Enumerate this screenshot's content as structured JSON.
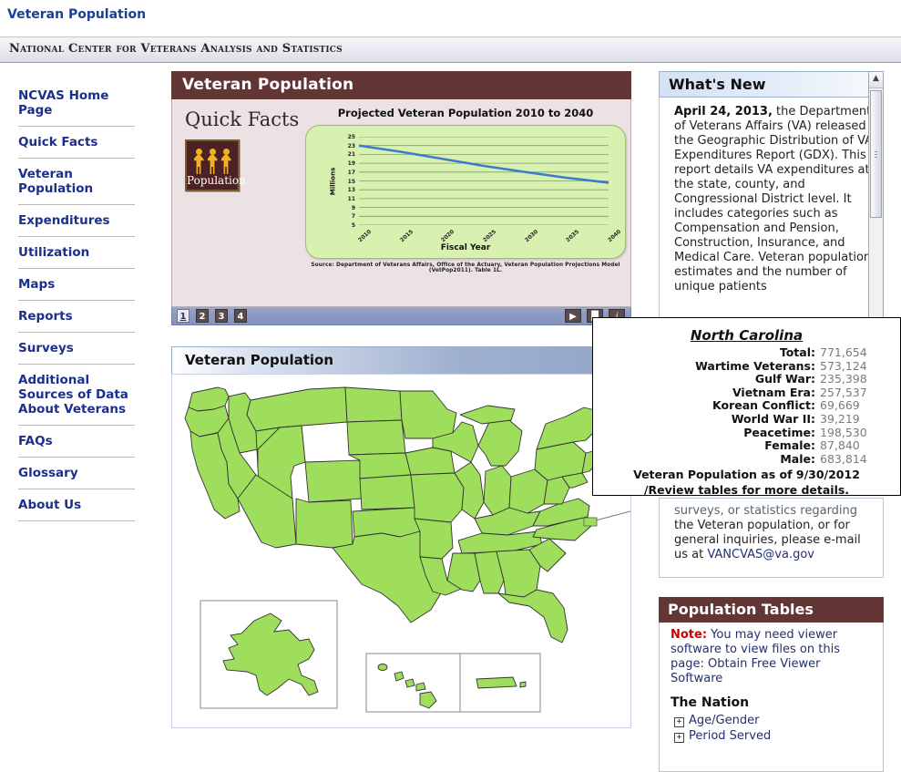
{
  "page": {
    "title": "Veteran Population"
  },
  "banner": {
    "text": "National Center for Veterans Analysis and Statistics"
  },
  "sidebar": {
    "items": [
      {
        "label": "NCVAS Home Page"
      },
      {
        "label": "Quick Facts"
      },
      {
        "label": "Veteran Population"
      },
      {
        "label": "Expenditures"
      },
      {
        "label": "Utilization"
      },
      {
        "label": "Maps"
      },
      {
        "label": "Reports"
      },
      {
        "label": "Surveys"
      },
      {
        "label": "Additional Sources of Data About Veterans"
      },
      {
        "label": "FAQs"
      },
      {
        "label": "Glossary"
      },
      {
        "label": "About Us"
      }
    ]
  },
  "quickfacts": {
    "header": "Veteran Population",
    "heading": "Quick Facts",
    "icon_caption": "Population",
    "slides": [
      "1",
      "2",
      "3",
      "4"
    ],
    "active_slide": "1",
    "play_label": "▶",
    "pause_label": "▐▌",
    "info_label": "i"
  },
  "chart_data": {
    "type": "line",
    "title": "Projected Veteran Population 2010 to 2040",
    "xlabel": "Fiscal Year",
    "ylabel": "Millions",
    "x": [
      "2010",
      "2015",
      "2020",
      "2025",
      "2030",
      "2035",
      "2040"
    ],
    "values": [
      23.0,
      21.6,
      20.0,
      18.4,
      17.0,
      15.7,
      14.6
    ],
    "ylim": [
      5,
      25
    ],
    "yticks": [
      25,
      23,
      21,
      19,
      17,
      15,
      13,
      11,
      9,
      7,
      5
    ],
    "grid": true,
    "legend": "none",
    "line_color": "#3e7bc8",
    "plot_bg": "#d8f0b0",
    "source": "Source: Department of Veterans Affairs, Office of the Actuary, Veteran Population Projections Model (VetPop2011).  Table 1L."
  },
  "map_module": {
    "header": "Veteran Population",
    "selected_state": "North Carolina"
  },
  "whats_new": {
    "header": "What's New",
    "date": "April 24, 2013,",
    "body": " the Department of Veterans Affairs (VA) released the Geographic Distribution of VA Expenditures Report (GDX). This report details VA expenditures at the state, county, and Congressional District level. It includes categories such as Compensation and Pension, Construction, Insurance, and Medical Care. Veteran population estimates and the number of unique patients"
  },
  "contact": {
    "line1": "surveys, or statistics regarding",
    "line2": "the Veteran population, or for",
    "line3": "general inquiries, please e-mail",
    "line4_prefix": "us at ",
    "email": "VANCVAS@va.gov"
  },
  "population_tables": {
    "header": "Population Tables",
    "note_label": "Note:",
    "note_text": " You may need viewer software to view files on this page: ",
    "note_link": "Obtain Free Viewer Software",
    "section": "The Nation",
    "items": [
      {
        "label": "Age/Gender",
        "toggle": "+"
      },
      {
        "label": "Period Served",
        "toggle": "+"
      }
    ]
  },
  "tooltip": {
    "title": "North Carolina",
    "rows": [
      {
        "label": "Total:",
        "value": "771,654"
      },
      {
        "label": "Wartime Veterans:",
        "value": "573,124"
      },
      {
        "label": "Gulf War:",
        "value": "235,398"
      },
      {
        "label": "Vietnam Era:",
        "value": "257,537"
      },
      {
        "label": "Korean Conflict:",
        "value": "69,669"
      },
      {
        "label": "World War II:",
        "value": "39,219"
      },
      {
        "label": "Peacetime:",
        "value": "198,530"
      },
      {
        "label": "Female:",
        "value": "87,840"
      },
      {
        "label": "Male:",
        "value": "683,814"
      }
    ],
    "footer_line1": "Veteran Population as of 9/30/2012",
    "footer_line2": "/Review tables for more details."
  },
  "colors": {
    "maroon": "#633636",
    "link_blue": "#1c2f8c",
    "map_green": "#9ede5c",
    "chart_line": "#3e7bc8"
  }
}
